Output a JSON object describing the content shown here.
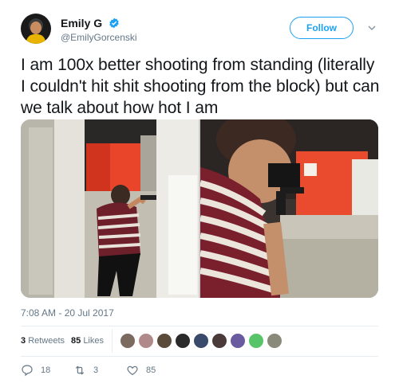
{
  "user": {
    "display_name": "Emily G",
    "handle": "@EmilyGorcenski",
    "verified_icon": "verified-badge-icon"
  },
  "header": {
    "follow_label": "Follow",
    "menu_icon": "chevron-down-icon"
  },
  "tweet": {
    "text": "I am 100x better shooting from standing (literally I couldn't hit shit shooting from the block) but can we talk about how hot I am",
    "timestamp": "7:08 AM - 20 Jul 2017"
  },
  "stats": {
    "retweets_count": "3",
    "retweets_label": "Retweets",
    "likes_count": "85",
    "likes_label": "Likes"
  },
  "actions": {
    "reply_count": "18",
    "retweet_count": "3",
    "like_count": "85"
  },
  "colors": {
    "accent": "#1da1f2",
    "muted": "#657786",
    "text": "#14171a",
    "divider": "#e6ecf0"
  }
}
